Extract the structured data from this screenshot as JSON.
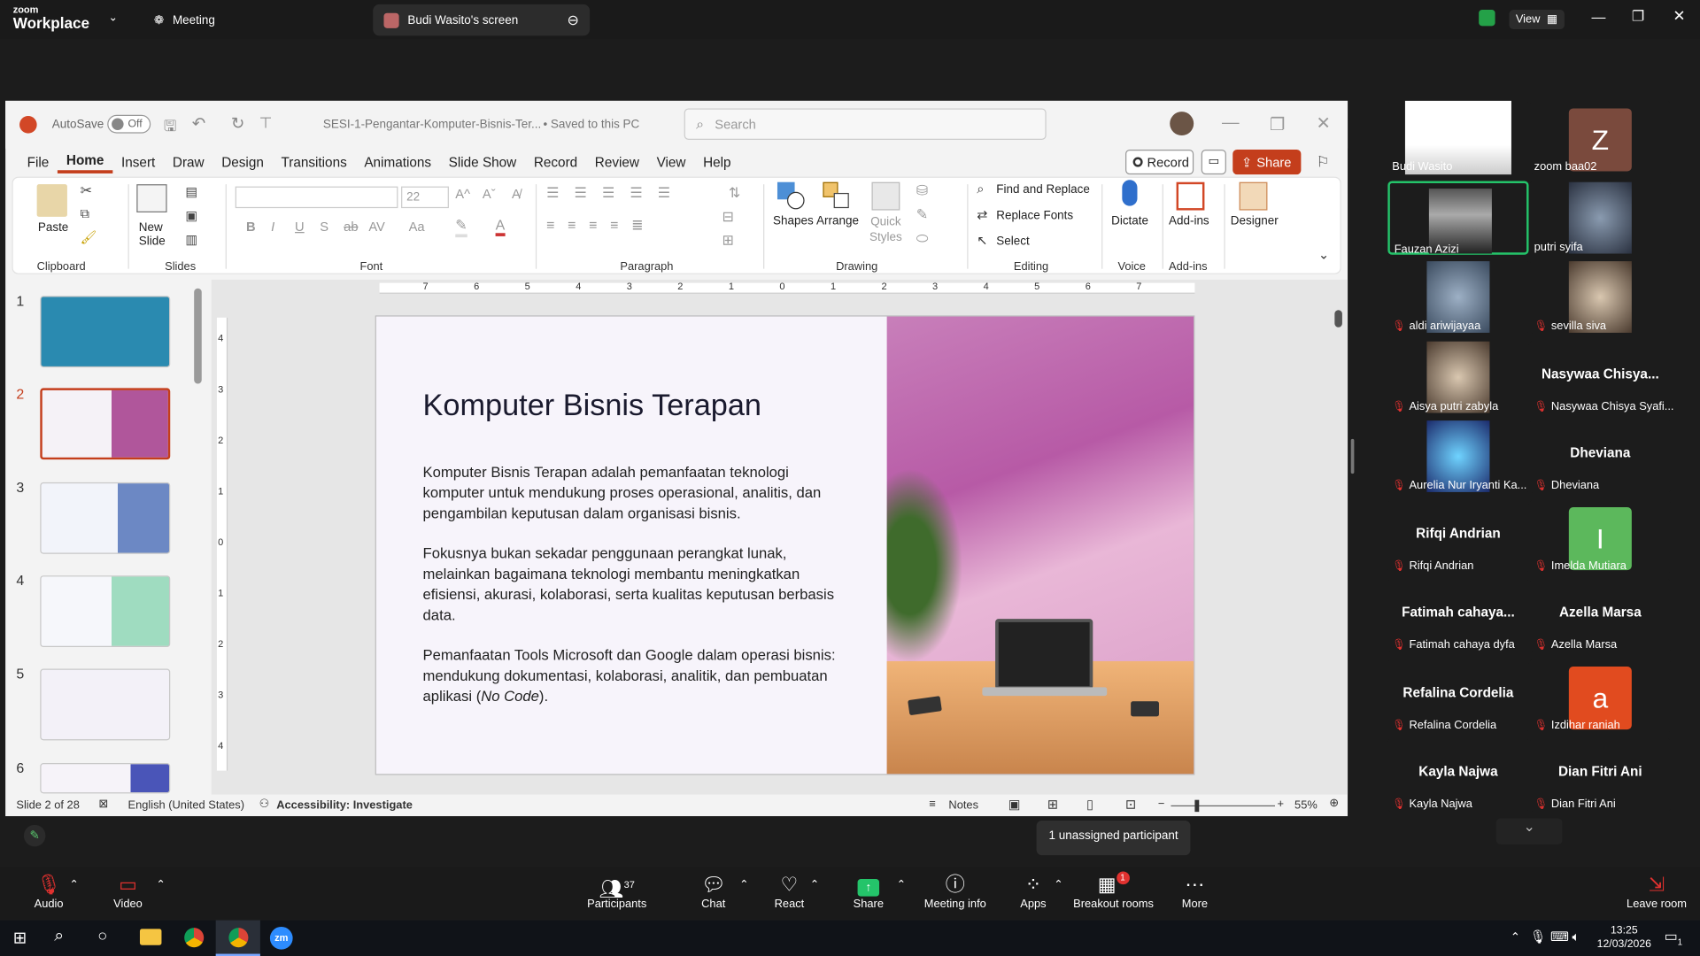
{
  "zoom": {
    "logo_top": "zoom",
    "logo_bottom": "Workplace",
    "meeting_tab": "Meeting",
    "screen_tab": "Budi Wasito's screen",
    "view_label": "View"
  },
  "ppt": {
    "autosave": "AutoSave",
    "autosave_state": "Off",
    "doc_title": "SESI-1-Pengantar-Komputer-Bisnis-Ter...",
    "saved": "• Saved to this PC",
    "search_placeholder": "Search",
    "record": "Record",
    "share": "Share",
    "menu": [
      "File",
      "Home",
      "Insert",
      "Draw",
      "Design",
      "Transitions",
      "Animations",
      "Slide Show",
      "Record",
      "Review",
      "View",
      "Help"
    ],
    "ribbon": {
      "paste": "Paste",
      "new_slide": "New Slide",
      "font_size": "22",
      "shapes": "Shapes",
      "arrange": "Arrange",
      "quick_styles": "Quick Styles",
      "find_replace": "Find and Replace",
      "replace_fonts": "Replace Fonts",
      "select": "Select",
      "dictate": "Dictate",
      "addins": "Add-ins",
      "designer": "Designer",
      "groups": {
        "clipboard": "Clipboard",
        "slides": "Slides",
        "font": "Font",
        "paragraph": "Paragraph",
        "drawing": "Drawing",
        "editing": "Editing",
        "voice": "Voice",
        "addins": "Add-ins"
      }
    },
    "ruler": [
      "7",
      "6",
      "5",
      "4",
      "3",
      "2",
      "1",
      "0",
      "1",
      "2",
      "3",
      "4",
      "5",
      "6",
      "7"
    ],
    "vruler": [
      "4",
      "3",
      "2",
      "1",
      "0",
      "1",
      "2",
      "3",
      "4"
    ],
    "thumbs": [
      "1",
      "2",
      "3",
      "4",
      "5",
      "6"
    ],
    "slide": {
      "title": "Komputer Bisnis Terapan",
      "p1": "Komputer Bisnis Terapan adalah pemanfaatan teknologi komputer untuk mendukung proses operasional, analitis, dan pengambilan keputusan dalam organisasi bisnis.",
      "p2": "Fokusnya bukan sekadar penggunaan perangkat lunak, melainkan bagaimana teknologi membantu meningkatkan efisiensi, akurasi, kolaborasi, serta kualitas keputusan berbasis data.",
      "p3a": "Pemanfaatan Tools Microsoft dan Google dalam operasi bisnis: mendukung dokumentasi, kolaborasi, analitik, dan pembuatan aplikasi (",
      "p3b": "No Code",
      "p3c": ")."
    },
    "status": {
      "slide": "Slide 2 of 28",
      "lang": "English (United States)",
      "access": "Accessibility: Investigate",
      "notes": "Notes",
      "zoom": "55%"
    }
  },
  "participants_gallery": [
    {
      "name": "Budi Wasito",
      "muted": false,
      "kind": "video"
    },
    {
      "name": "zoom baa02",
      "muted": false,
      "kind": "avatar",
      "letter": "Z",
      "color": "#7a4a3d"
    },
    {
      "name": "Fauzan Azizi",
      "muted": false,
      "kind": "video"
    },
    {
      "name": "putri syifa",
      "muted": false,
      "kind": "blur"
    },
    {
      "name": "aldi ariwijayaa",
      "muted": true,
      "kind": "map"
    },
    {
      "name": "sevilla siva",
      "muted": true,
      "kind": "photo"
    },
    {
      "name": "Aisya putri zabyla",
      "muted": true,
      "kind": "photo"
    },
    {
      "name": "Nasywaa Chisya Syafi...",
      "muted": true,
      "kind": "text",
      "display": "Nasywaa  Chisya..."
    },
    {
      "name": "Aurelia Nur Iryanti Ka...",
      "muted": true,
      "kind": "neon"
    },
    {
      "name": "Dheviana",
      "muted": true,
      "kind": "text",
      "display": "Dheviana"
    },
    {
      "name": "Rifqi Andrian",
      "muted": true,
      "kind": "text",
      "display": "Rifqi Andrian"
    },
    {
      "name": "Imelda Mutiara",
      "muted": true,
      "kind": "avatar",
      "letter": "I",
      "color": "#5cb85c"
    },
    {
      "name": "Fatimah cahaya dyfa",
      "muted": true,
      "kind": "text",
      "display": "Fatimah  cahaya..."
    },
    {
      "name": "Azella Marsa",
      "muted": true,
      "kind": "text",
      "display": "Azella Marsa"
    },
    {
      "name": "Refalina Cordelia",
      "muted": true,
      "kind": "text",
      "display": "Refalina Cordelia"
    },
    {
      "name": "Izdihar raniah",
      "muted": true,
      "kind": "avatar",
      "letter": "a",
      "color": "#e14b1f"
    },
    {
      "name": "Kayla Najwa",
      "muted": true,
      "kind": "text",
      "display": "Kayla Najwa"
    },
    {
      "name": "Dian Fitri Ani",
      "muted": true,
      "kind": "text",
      "display": "Dian Fitri Ani"
    }
  ],
  "unassigned": "1 unassigned participant",
  "toolbar": {
    "audio": "Audio",
    "video": "Video",
    "participants": "Participants",
    "participants_count": "37",
    "chat": "Chat",
    "react": "React",
    "share": "Share",
    "meeting_info": "Meeting info",
    "apps": "Apps",
    "breakout": "Breakout rooms",
    "breakout_badge": "1",
    "more": "More",
    "leave": "Leave room"
  },
  "taskbar": {
    "time": "13:25",
    "date": "12/03/2026",
    "notif": "1"
  }
}
